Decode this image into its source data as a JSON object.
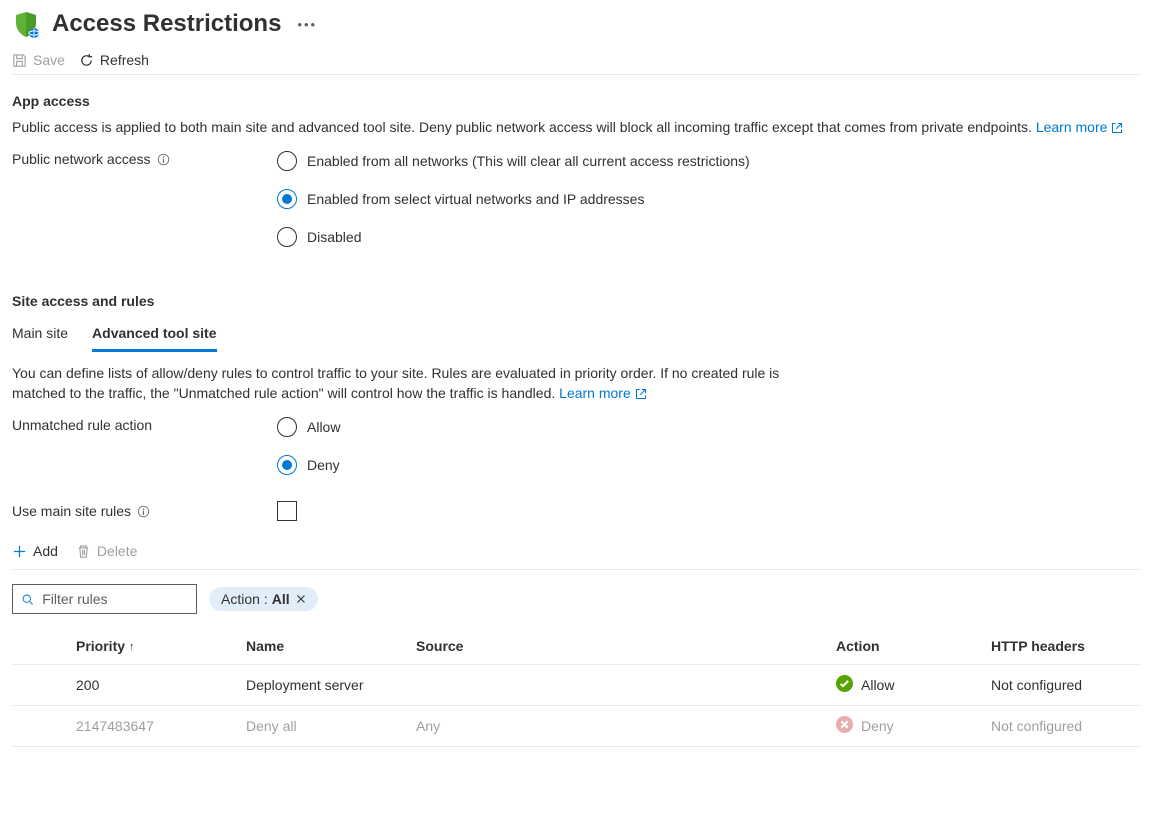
{
  "header": {
    "title": "Access Restrictions"
  },
  "toolbar": {
    "save_label": "Save",
    "refresh_label": "Refresh"
  },
  "app_access": {
    "heading": "App access",
    "description": "Public access is applied to both main site and advanced tool site. Deny public network access will block all incoming traffic except that comes from private endpoints.",
    "learn_more": "Learn more",
    "public_label": "Public network access",
    "options": {
      "all": "Enabled from all networks (This will clear all current access restrictions)",
      "select": "Enabled from select virtual networks and IP addresses",
      "disabled": "Disabled"
    }
  },
  "site_access": {
    "heading": "Site access and rules",
    "tabs": {
      "main": "Main site",
      "advanced": "Advanced tool site"
    },
    "description": "You can define lists of allow/deny rules to control traffic to your site. Rules are evaluated in priority order. If no created rule is matched to the traffic, the \"Unmatched rule action\" will control how the traffic is handled.",
    "learn_more": "Learn more",
    "unmatched_label": "Unmatched rule action",
    "unmatched_options": {
      "allow": "Allow",
      "deny": "Deny"
    },
    "use_main_label": "Use main site rules"
  },
  "rules_toolbar": {
    "add": "Add",
    "delete": "Delete"
  },
  "filter": {
    "placeholder": "Filter rules",
    "pill_label": "Action : ",
    "pill_value": "All"
  },
  "table": {
    "headers": {
      "priority": "Priority",
      "name": "Name",
      "source": "Source",
      "action": "Action",
      "http": "HTTP headers"
    },
    "rows": [
      {
        "priority": "200",
        "name": "Deployment server",
        "source": "",
        "action": "Allow",
        "http": "Not configured",
        "status": "allow",
        "muted": false
      },
      {
        "priority": "2147483647",
        "name": "Deny all",
        "source": "Any",
        "action": "Deny",
        "http": "Not configured",
        "status": "deny",
        "muted": true
      }
    ]
  }
}
